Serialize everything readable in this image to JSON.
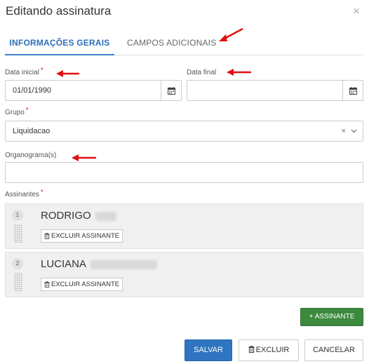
{
  "dialog": {
    "title": "Editando assinatura",
    "close_icon": "×"
  },
  "tabs": [
    {
      "label": "INFORMAÇÕES GERAIS"
    },
    {
      "label": "CAMPOS ADICIONAIS"
    }
  ],
  "form": {
    "start_date": {
      "label": "Data inicial",
      "required": "*",
      "value": "01/01/1990"
    },
    "end_date": {
      "label": "Data final",
      "value": ""
    },
    "group": {
      "label": "Grupo",
      "required": "*",
      "value": "Liquidacao",
      "clear": "×"
    },
    "orgchart": {
      "label": "Organograma(s)",
      "value": ""
    },
    "signers": {
      "label": "Assinantes",
      "required": "*",
      "items": [
        {
          "index": "1",
          "name": "RODRIGO",
          "delete_label": "EXCLUIR ASSINANTE"
        },
        {
          "index": "2",
          "name": "LUCIANA",
          "delete_label": "EXCLUIR ASSINANTE"
        }
      ]
    }
  },
  "buttons": {
    "add_signer": "ASSINANTE",
    "add_signer_prefix": "+",
    "save": "SALVAR",
    "delete": "EXCLUIR",
    "cancel": "CANCELAR"
  },
  "colors": {
    "primary": "#2f74c0",
    "success": "#3c8a3d",
    "required": "#d9232d",
    "annotation_arrow": "#e01010"
  },
  "icons": [
    "close-icon",
    "calendar-icon",
    "chevron-down-icon",
    "trash-icon",
    "drag-handle-icon"
  ]
}
